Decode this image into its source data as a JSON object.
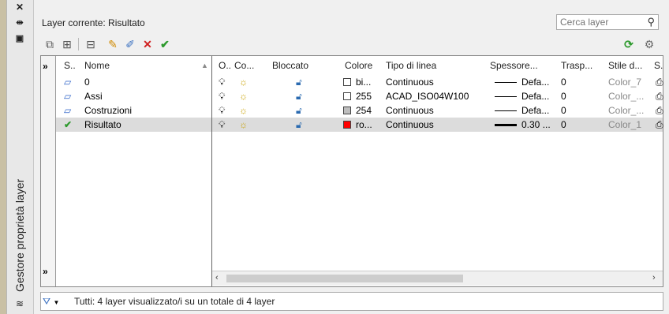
{
  "palette": {
    "title": "Gestore proprietà layer"
  },
  "header": {
    "current_layer": "Layer corrente: Risultato",
    "search_placeholder": "Cerca layer"
  },
  "columns": {
    "status": "S..",
    "name": "Nome",
    "on": "O..",
    "freeze": "Co...",
    "lock": "Bloccato",
    "color": "Colore",
    "linetype": "Tipo di linea",
    "lineweight": "Spessore...",
    "transparency": "Trasp...",
    "plotstyle": "Stile d...",
    "plot": "S."
  },
  "layers": [
    {
      "name": "0",
      "color_name": "bi...",
      "color_hex": "#ffffff",
      "linetype": "Continuous",
      "lineweight": "Defa...",
      "transparency": "0",
      "plotstyle": "Color_7",
      "current": false
    },
    {
      "name": "Assi",
      "color_name": "255",
      "color_hex": "#ffffff",
      "linetype": "ACAD_ISO04W100",
      "lineweight": "Defa...",
      "transparency": "0",
      "plotstyle": "Color_...",
      "current": false
    },
    {
      "name": "Costruzioni",
      "color_name": "254",
      "color_hex": "#bebebe",
      "linetype": "Continuous",
      "lineweight": "Defa...",
      "transparency": "0",
      "plotstyle": "Color_...",
      "current": false
    },
    {
      "name": "Risultato",
      "color_name": "ro...",
      "color_hex": "#ff0000",
      "linetype": "Continuous",
      "lineweight": "0.30 ...",
      "transparency": "0",
      "plotstyle": "Color_1",
      "current": true
    }
  ],
  "status_bar": {
    "text": "Tutti: 4 layer visualizzato/i su un totale di 4 layer"
  }
}
